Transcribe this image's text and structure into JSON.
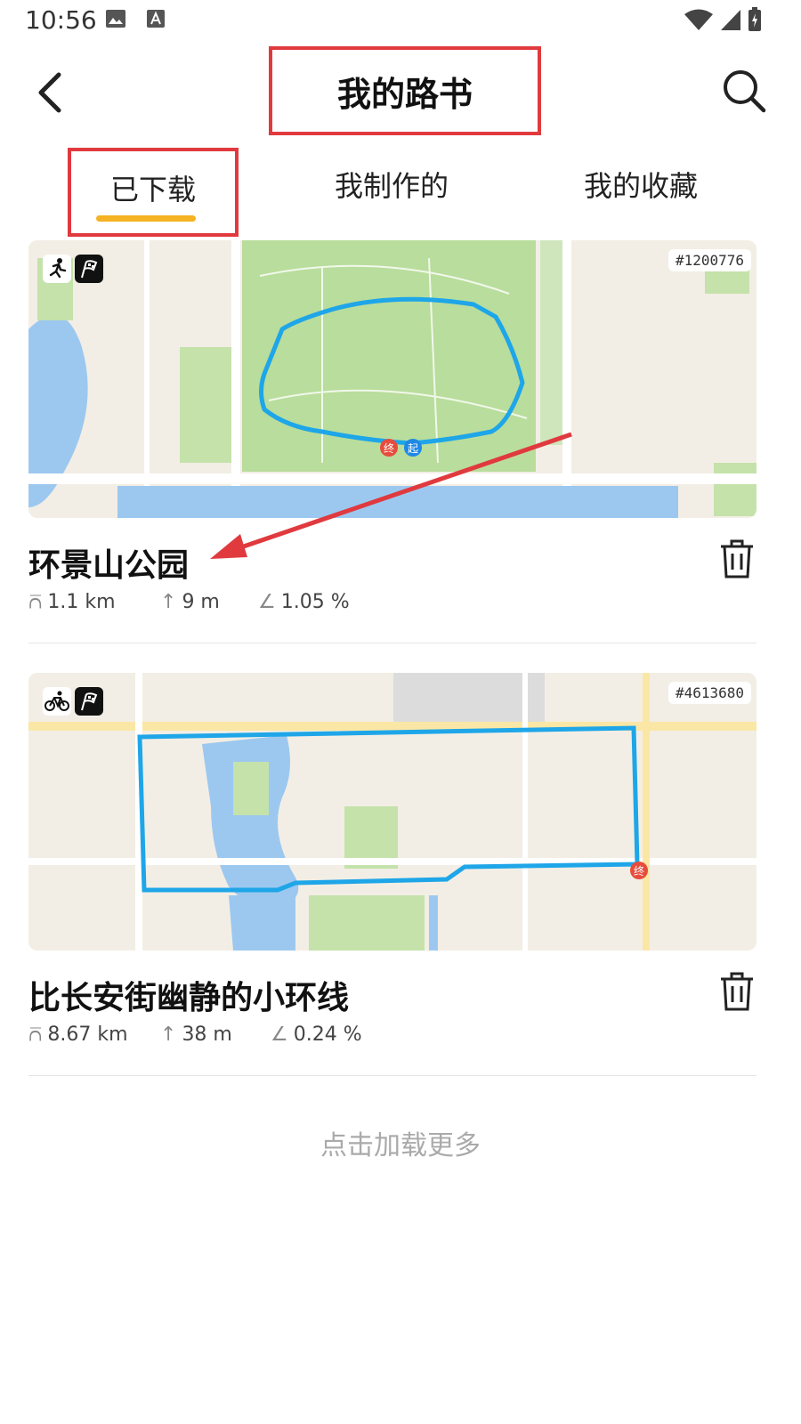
{
  "status_bar": {
    "time": "10:56"
  },
  "header": {
    "title": "我的路书"
  },
  "tabs": [
    {
      "label": "已下载",
      "active": true
    },
    {
      "label": "我制作的",
      "active": false
    },
    {
      "label": "我的收藏",
      "active": false
    }
  ],
  "routes": [
    {
      "id": "#1200776",
      "title": "环景山公园",
      "sport_icon": "running-icon",
      "distance": "1.1 km",
      "ascent": "9 m",
      "grade": "1.05 %"
    },
    {
      "id": "#4613680",
      "title": "比长安街幽静的小环线",
      "sport_icon": "cycling-icon",
      "distance": "8.67 km",
      "ascent": "38 m",
      "grade": "0.24 %"
    }
  ],
  "load_more": "点击加载更多",
  "colors": {
    "accent_underline": "#f5b223",
    "annotation_red": "#e03a3e",
    "route_line": "#1ea6e8"
  }
}
